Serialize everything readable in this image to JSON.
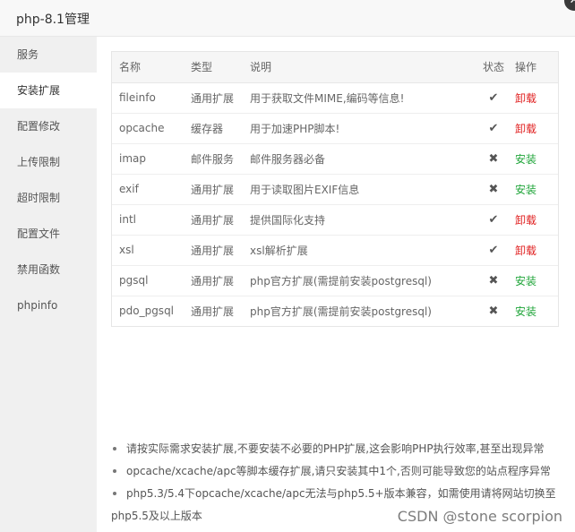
{
  "window": {
    "title": "php-8.1管理",
    "close_glyph": "✕"
  },
  "sidebar": {
    "items": [
      {
        "label": "服务",
        "active": false
      },
      {
        "label": "安装扩展",
        "active": true
      },
      {
        "label": "配置修改",
        "active": false
      },
      {
        "label": "上传限制",
        "active": false
      },
      {
        "label": "超时限制",
        "active": false
      },
      {
        "label": "配置文件",
        "active": false
      },
      {
        "label": "禁用函数",
        "active": false
      },
      {
        "label": "phpinfo",
        "active": false
      }
    ]
  },
  "table": {
    "headers": {
      "name": "名称",
      "type": "类型",
      "desc": "说明",
      "status": "状态",
      "op": "操作"
    },
    "rows": [
      {
        "name": "fileinfo",
        "type": "通用扩展",
        "desc": "用于获取文件MIME,编码等信息!",
        "installed": true,
        "op": "卸载"
      },
      {
        "name": "opcache",
        "type": "缓存器",
        "desc": "用于加速PHP脚本!",
        "installed": true,
        "op": "卸载"
      },
      {
        "name": "imap",
        "type": "邮件服务",
        "desc": "邮件服务器必备",
        "installed": false,
        "op": "安装"
      },
      {
        "name": "exif",
        "type": "通用扩展",
        "desc": "用于读取图片EXIF信息",
        "installed": false,
        "op": "安装"
      },
      {
        "name": "intl",
        "type": "通用扩展",
        "desc": "提供国际化支持",
        "installed": true,
        "op": "卸载"
      },
      {
        "name": "xsl",
        "type": "通用扩展",
        "desc": "xsl解析扩展",
        "installed": true,
        "op": "卸载"
      },
      {
        "name": "pgsql",
        "type": "通用扩展",
        "desc": "php官方扩展(需提前安装postgresql)",
        "installed": false,
        "op": "安装"
      },
      {
        "name": "pdo_pgsql",
        "type": "通用扩展",
        "desc": "php官方扩展(需提前安装postgresql)",
        "installed": false,
        "op": "安装"
      }
    ]
  },
  "tips": [
    "请按实际需求安装扩展,不要安装不必要的PHP扩展,这会影响PHP执行效率,甚至出现异常",
    "opcache/xcache/apc等脚本缓存扩展,请只安装其中1个,否则可能导致您的站点程序异常",
    "php5.3/5.4下opcache/xcache/apc无法与php5.5+版本兼容，如需使用请将网站切换至php5.5及以上版本"
  ],
  "watermark": "CSDN @stone scorpion",
  "icons": {
    "installed": "check-icon",
    "not_installed": "cross-icon"
  },
  "colors": {
    "uninstall_link": "#e02020",
    "install_link": "#20a53a",
    "active_nav_bg": "#ffffff",
    "sidebar_bg": "#f0f0f0"
  }
}
